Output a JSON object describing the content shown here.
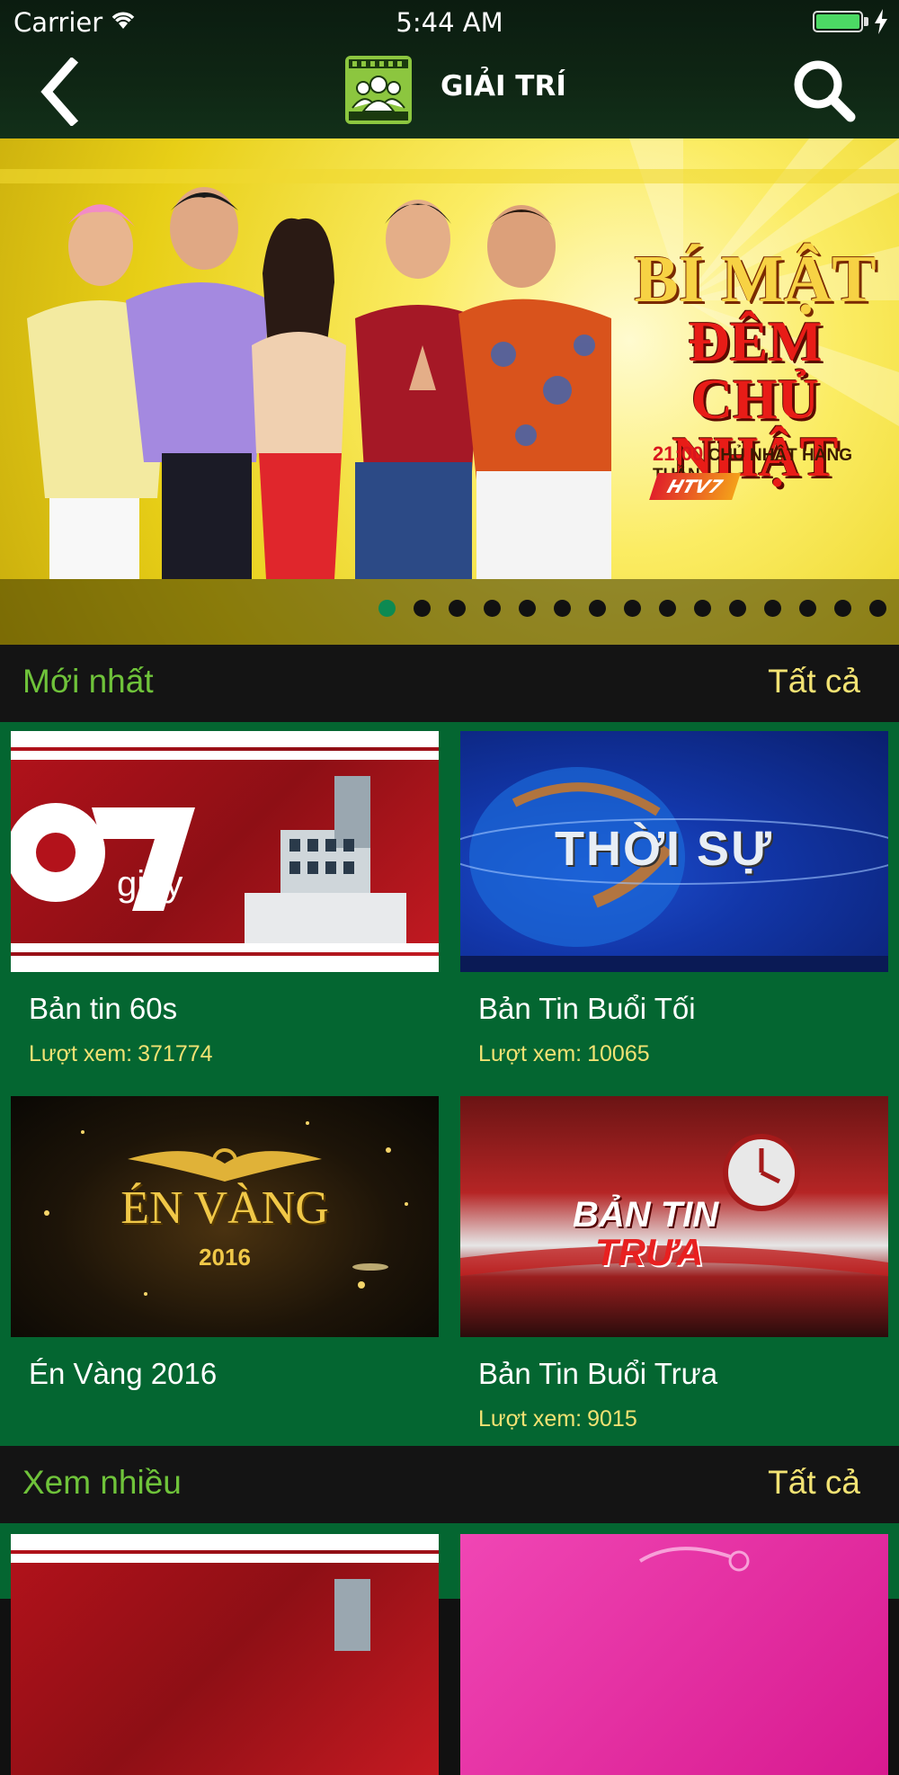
{
  "status_bar": {
    "carrier": "Carrier",
    "time": "5:44 AM"
  },
  "nav": {
    "title": "GIẢI TRÍ",
    "back_icon": "chevron-left-icon",
    "category_icon": "people-film-icon",
    "search_icon": "search-icon"
  },
  "banner": {
    "title_line1": "BÍ MẬT",
    "title_line2": "ĐÊM CHỦ NHẬT",
    "schedule_time": "21:00",
    "schedule_text": "CHỦ NHẬT HÀNG TUẦN",
    "channel": "HTV7",
    "slide_count": 15,
    "active_slide": 1
  },
  "sections": [
    {
      "name": "Mới nhất",
      "see_all": "Tất cả",
      "items": [
        {
          "title": "Bản tin 60s",
          "views_label": "Lượt xem:",
          "views": "371774",
          "thumb_text": "giây"
        },
        {
          "title": "Bản Tin Buổi Tối",
          "views_label": "Lượt xem:",
          "views": "10065",
          "thumb_text": "THỜI SỰ"
        },
        {
          "title": "Én Vàng 2016",
          "views_label": "",
          "views": "",
          "thumb_text": "ÉN VÀNG",
          "thumb_sub": "2016"
        },
        {
          "title": "Bản Tin Buổi Trưa",
          "views_label": "Lượt xem:",
          "views": "9015",
          "thumb_text": "BẢN TIN",
          "thumb_sub": "TRƯA"
        }
      ]
    },
    {
      "name": "Xem nhiều",
      "see_all": "Tất cả"
    }
  ],
  "colors": {
    "section_title": "#6fc33a",
    "see_all": "#f2e273",
    "grid_background": "#046631",
    "active_dot": "#0d8a52"
  }
}
